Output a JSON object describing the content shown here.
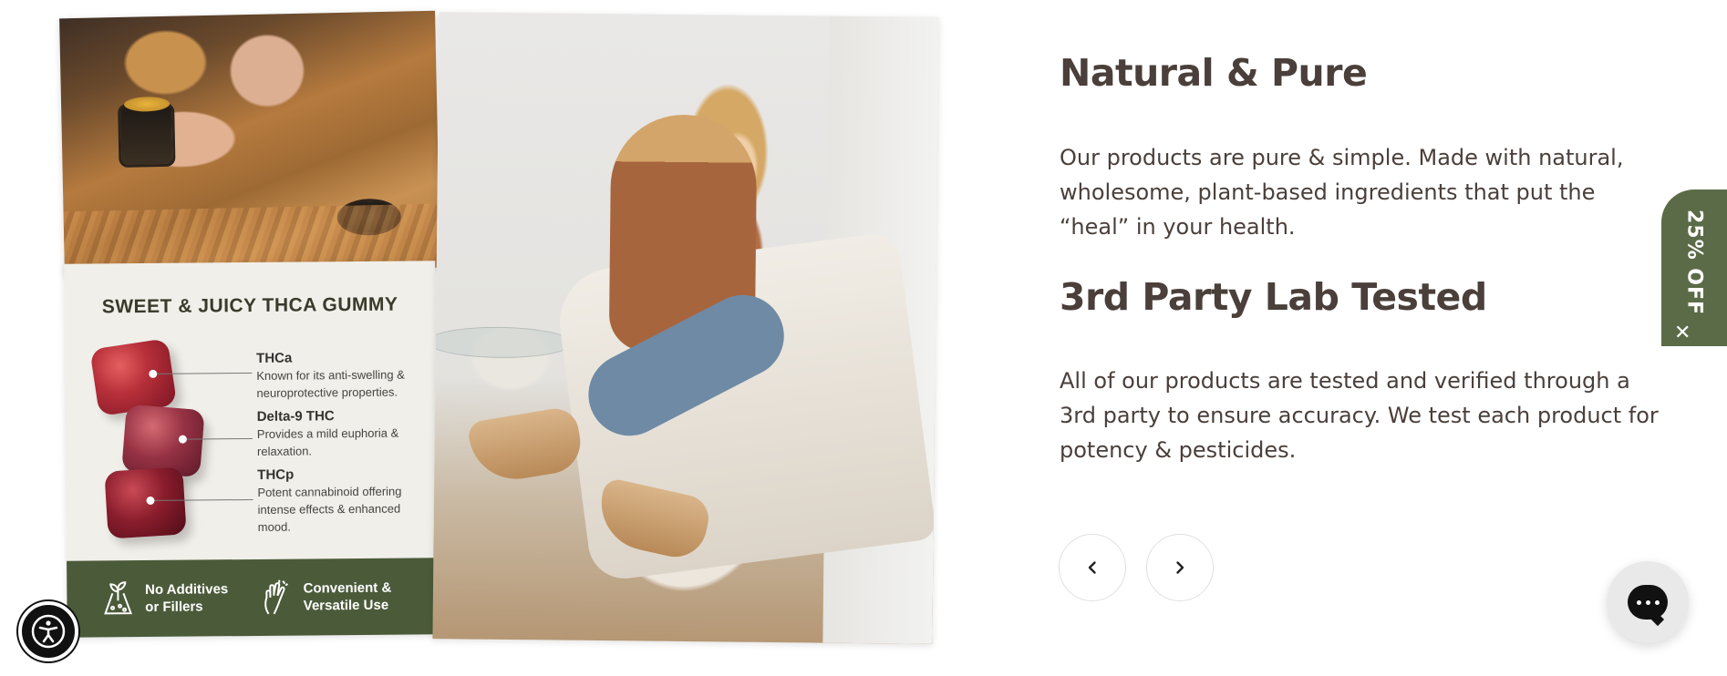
{
  "sections": [
    {
      "title": "Natural & Pure",
      "body": "Our products are pure & simple. Made with natural, wholesome, plant-based ingredients that put the “heal” in your health."
    },
    {
      "title": "3rd Party Lab Tested",
      "body": "All of our products are tested and verified through a 3rd party to ensure accuracy. We test each product for potency & pesticides."
    }
  ],
  "infographic": {
    "title": "SWEET & JUICY THCA GUMMY",
    "compounds": [
      {
        "name": "THCa",
        "desc": "Known for its anti-swelling & neuroprotective properties."
      },
      {
        "name": "Delta-9 THC",
        "desc": "Provides a mild euphoria & relaxation."
      },
      {
        "name": "THCp",
        "desc": "Potent cannabinoid offering intense effects & enhanced mood."
      }
    ],
    "features": [
      {
        "label": "No Additives or Fillers",
        "icon": "plant-flask-icon"
      },
      {
        "label": "Convenient & Versatile Use",
        "icon": "hand-icon"
      }
    ]
  },
  "carousel": {
    "prev_icon": "chevron-left-icon",
    "next_icon": "chevron-right-icon"
  },
  "discount_tab": {
    "label": "25% OFF",
    "close_glyph": "✕"
  },
  "colors": {
    "text": "#4a3f3a",
    "accent_green": "#5b6b47",
    "footer_green": "#4b5b3a"
  }
}
